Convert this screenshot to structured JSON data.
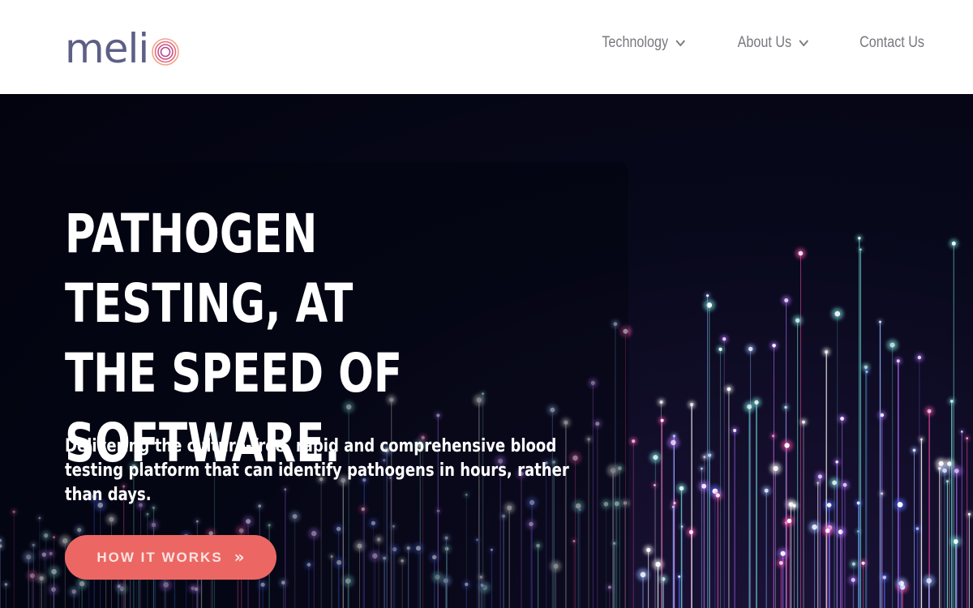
{
  "brand": {
    "logo_text": "meli",
    "logo_o": "o",
    "logo_color": "#5d5f86",
    "logo_ring_colors": [
      "#f3a38f",
      "#e86a7a",
      "#b8488f"
    ]
  },
  "nav": {
    "items": [
      {
        "label": "Technology",
        "has_dropdown": true
      },
      {
        "label": "About Us",
        "has_dropdown": true
      },
      {
        "label": "Contact Us",
        "has_dropdown": false
      }
    ]
  },
  "hero": {
    "headline": "PATHOGEN TESTING, AT\nTHE SPEED OF\nSOFTWARE.",
    "subtext": "Delivering the culture-free, rapid and comprehensive blood testing platform that can identify pathogens in hours, rather than days.",
    "cta": {
      "label": "HOW IT WORKS",
      "icon": "double-chevron-right-icon",
      "color": "#ec6763"
    },
    "background_palette": [
      "#ffffff",
      "#8fb5ff",
      "#4f6bff",
      "#b06bff",
      "#ff4fb0",
      "#6fe0d8"
    ]
  }
}
